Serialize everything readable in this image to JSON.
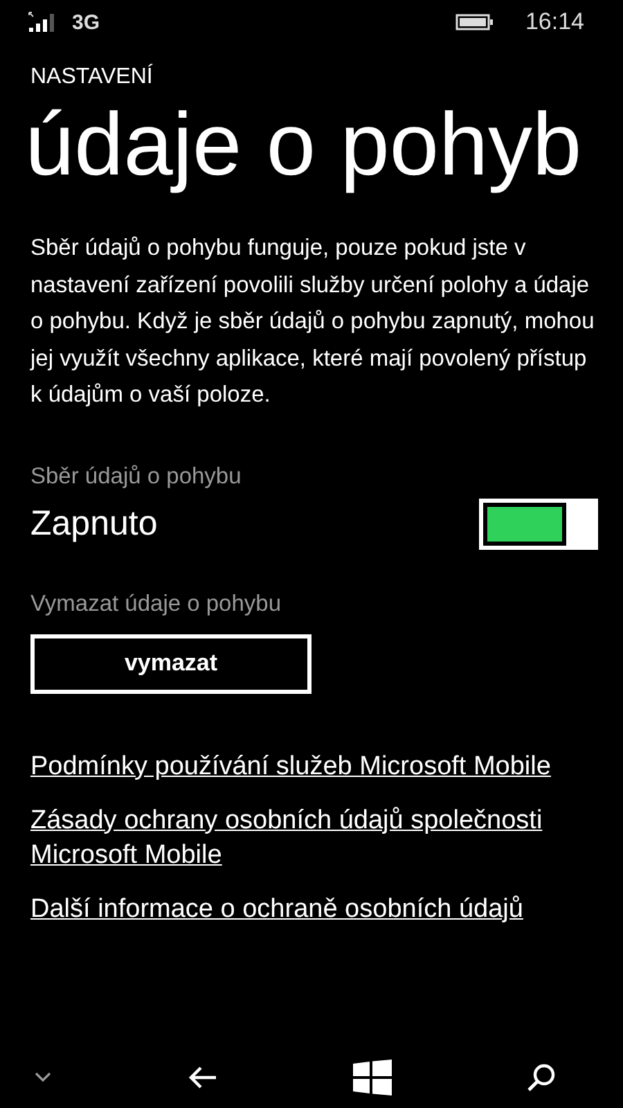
{
  "status_bar": {
    "network": "3G",
    "time": "16:14"
  },
  "header": {
    "section": "NASTAVENÍ",
    "title": "údaje o pohyb"
  },
  "description": "Sběr údajů o pohybu funguje, pouze pokud jste v nastavení zařízení povolili služby určení polohy a údaje o pohybu. Když je sběr údajů o pohybu zapnutý, mohou jej využít všechny aplikace, které mají povolený přístup k údajům o vaší poloze.",
  "toggle": {
    "label": "Sběr údajů o pohybu",
    "state_text": "Zapnuto",
    "on": true
  },
  "clear": {
    "label": "Vymazat údaje o pohybu",
    "button": "vymazat"
  },
  "links": [
    "Podmínky používání služeb Microsoft Mobile",
    "Zásady ochrany osobních údajů společnosti Microsoft Mobile",
    "Další informace o ochraně osobních údajů"
  ]
}
